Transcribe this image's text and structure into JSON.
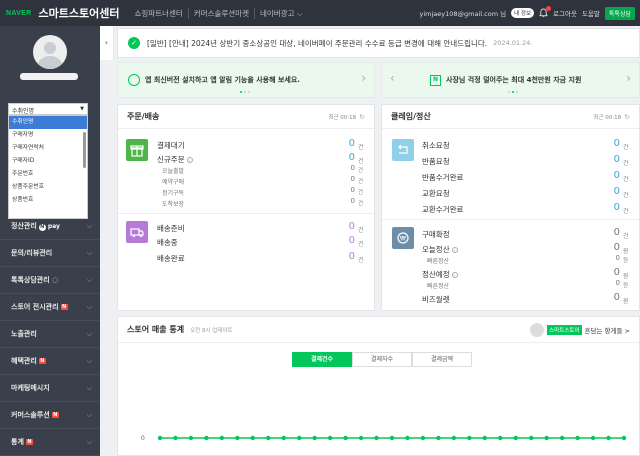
{
  "topbar": {
    "logo": "NAVER",
    "brand": "스마트스토어센터",
    "nav": [
      "쇼핑파트너센터",
      "커머스솔루션마켓",
      "네이버광고 ⌵"
    ],
    "email": "yimjaey108@gmail.com 님",
    "biz_badge": "내 정보",
    "logout": "로그아웃",
    "help": "도움말",
    "talk": "톡톡상담"
  },
  "sidebar": {
    "select_value": "수취인명",
    "options": [
      "수취인명",
      "구매자명",
      "구매자연락처",
      "구매자ID",
      "주문번호",
      "상품주문번호",
      "상품번호"
    ],
    "active_option": 0,
    "menu": [
      {
        "label": "정산관리",
        "extra": "pay"
      },
      {
        "label": "문의/리뷰관리",
        "extra": ""
      },
      {
        "label": "톡톡상담관리",
        "extra": "talk"
      },
      {
        "label": "스토어 전시관리",
        "extra": "N"
      },
      {
        "label": "노출관리",
        "extra": ""
      },
      {
        "label": "혜택관리",
        "extra": "N"
      },
      {
        "label": "마케팅메시지",
        "extra": ""
      },
      {
        "label": "커머스솔루션",
        "extra": "N"
      },
      {
        "label": "통계",
        "extra": "N"
      }
    ],
    "npay_label": "pay"
  },
  "notice": {
    "text": "[일반] [안내] 2024년 상반기 중소상공인 대상, 네이버페이 주문관리 수수료 등급 변경에 대해 안내드립니다.",
    "date": "2024.01.24."
  },
  "banners": {
    "left": "앱 최신버전 설치하고 앱 알림 기능을 사용해 보세요.",
    "right": "사장님 걱정 덜어주는 최대 4천만원 자금 지원"
  },
  "order_card": {
    "title": "주문/배송",
    "updated": "최근 00:18",
    "group1": [
      {
        "label": "결제대기",
        "value": "0",
        "unit": "건",
        "sub": false
      },
      {
        "label": "신규주문",
        "value": "0",
        "unit": "건",
        "sub": false
      },
      {
        "label": "오늘출발",
        "value": "0",
        "unit": "건",
        "sub": true
      },
      {
        "label": "예약구매",
        "value": "0",
        "unit": "건",
        "sub": true
      },
      {
        "label": "정기구독",
        "value": "0",
        "unit": "건",
        "sub": true
      },
      {
        "label": "도착보장",
        "value": "0",
        "unit": "건",
        "sub": true
      }
    ],
    "group2": [
      {
        "label": "배송준비",
        "value": "0",
        "unit": "건"
      },
      {
        "label": "배송중",
        "value": "0",
        "unit": "건"
      },
      {
        "label": "배송완료",
        "value": "0",
        "unit": "건"
      }
    ]
  },
  "claim_card": {
    "title": "클레임/정산",
    "updated": "최근 00:18",
    "group1": [
      {
        "label": "취소요청",
        "value": "0",
        "unit": "건"
      },
      {
        "label": "반품요청",
        "value": "0",
        "unit": "건"
      },
      {
        "label": "반품수거완료",
        "value": "0",
        "unit": "건"
      },
      {
        "label": "교환요청",
        "value": "0",
        "unit": "건"
      },
      {
        "label": "교환수거완료",
        "value": "0",
        "unit": "건"
      }
    ],
    "group2": [
      {
        "label": "구매확정",
        "value": "0",
        "unit": "건",
        "sub": false
      },
      {
        "label": "오늘정산",
        "value": "0",
        "unit": "원",
        "sub": false
      },
      {
        "label": "빠른정산",
        "value": "0",
        "unit": "원",
        "sub": true
      },
      {
        "label": "정산예정",
        "value": "0",
        "unit": "원",
        "sub": false
      },
      {
        "label": "빠른정산",
        "value": "0",
        "unit": "원",
        "sub": true
      },
      {
        "label": "비즈월렛",
        "value": "0",
        "unit": "원",
        "sub": false
      }
    ]
  },
  "stats": {
    "title": "스토어 매출 통계",
    "updated": "오전 8시 업데이트",
    "store_tag": "스마트스토어",
    "store_name": "흔담는 항게들 >",
    "tabs": [
      "결제건수",
      "결제자수",
      "결제금액"
    ],
    "active_tab": 0
  },
  "chart_data": {
    "type": "line",
    "y_tick": "0",
    "values": [
      0,
      0,
      0,
      0,
      0,
      0,
      0,
      0,
      0,
      0,
      0,
      0,
      0,
      0,
      0,
      0,
      0,
      0,
      0,
      0,
      0,
      0,
      0,
      0,
      0,
      0,
      0,
      0,
      0,
      0,
      0
    ]
  },
  "colors": {
    "accent": "#03c75a",
    "count_blue": "#3fa5e0",
    "count_purple": "#b67bd9",
    "sidebar_bg": "#3a404b",
    "topbar_bg": "#2e333d"
  }
}
